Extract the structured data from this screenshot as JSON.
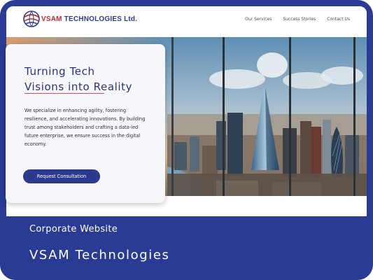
{
  "brand": {
    "name_part1": "VSAM",
    "name_part2": " TECHNOLOGIES Ltd."
  },
  "nav": {
    "items": [
      "Our Services",
      "Success Stories",
      "Contact Us"
    ]
  },
  "hero": {
    "headline_line1": "Turning Tech",
    "headline_line2": "Visions into Reality",
    "paragraph": "We specialize in enhancing agility, fostering resilience, and accelerating innovations. By building trust among stakeholders and crafting a data-led future enterprise, we ensure success in the digital economy.",
    "cta_label": "Request Consultation"
  },
  "caption": {
    "type": "Corporate Website",
    "client": "VSAM Technologies"
  },
  "colors": {
    "brand_blue": "#2a3b94",
    "brand_red": "#c8262c",
    "accent_rule": "#e25060"
  },
  "icons": {
    "logo": "globe-logo-icon"
  }
}
